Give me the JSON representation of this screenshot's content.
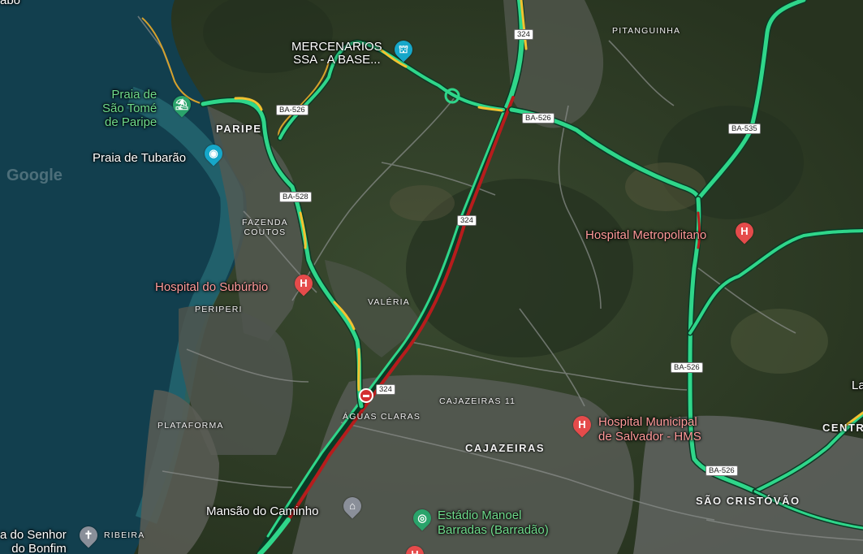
{
  "map": {
    "colors": {
      "sea": "#123f4e",
      "land": "#2f3a2c",
      "urban": "#5a5f5a",
      "traffic_fast": "#2fd68a",
      "traffic_medium": "#f2c230",
      "traffic_slow": "#b71c1c",
      "hospital": "#e54b4b",
      "tourism": "#16a7c9",
      "park": "#2aa36b"
    },
    "watermark": "Google",
    "route_shields": [
      {
        "name": "shield-324-north",
        "label": "324"
      },
      {
        "name": "shield-324-middle",
        "label": "324"
      },
      {
        "name": "shield-324-south",
        "label": "324"
      },
      {
        "name": "shield-ba526-paripe",
        "label": "BA-526"
      },
      {
        "name": "shield-ba526-east",
        "label": "BA-526"
      },
      {
        "name": "shield-ba528",
        "label": "BA-528"
      },
      {
        "name": "shield-ba535",
        "label": "BA-535"
      },
      {
        "name": "shield-ba526-south",
        "label": "BA-526"
      },
      {
        "name": "shield-ba526-bottom",
        "label": "BA-526"
      }
    ],
    "places": {
      "top_left_fragment": "abo",
      "mercenarios_line1": "MERCENARIOS",
      "mercenarios_line2": "SSA - A BASE...",
      "praia_sao_tome_line1": "Praia de",
      "praia_sao_tome_line2": "São Tomé",
      "praia_sao_tome_line3": "de Paripe",
      "praia_tubarao": "Praia de Tubarão",
      "hospital_metropolitano": "Hospital Metropolitano",
      "hospital_suburbio": "Hospital do Subúrbio",
      "hospital_municipal_line1": "Hospital Municipal",
      "hospital_municipal_line2": "de Salvador - HMS",
      "mansao_caminho": "Mansão do Caminho",
      "estadio_line1": "Estádio Manoel",
      "estadio_line2": "Barradas (Barradão)",
      "senhor_bonfim_line1": "a do Senhor",
      "senhor_bonfim_line2": "do Bonfim"
    },
    "neighborhoods": {
      "pitanguinha": "PITANGUINHA",
      "paripe": "PARIPE",
      "fazenda_coutos_line1": "FAZENDA",
      "fazenda_coutos_line2": "COUTOS",
      "periperi": "PERIPERI",
      "valeria": "VALÉRIA",
      "cajazeiras_11": "CAJAZEIRAS 11",
      "aguas_claras": "ÁGUAS CLARAS",
      "cajazeiras": "CAJAZEIRAS",
      "plataforma": "PLATAFORMA",
      "ribeira": "RIBEIRA",
      "sao_cristovao": "SÃO CRISTÓVÃO",
      "centro_fragment": "CENTR",
      "la_fragment": "La"
    },
    "icons": {
      "hospital": "hospital-pin-icon",
      "tourism": "camera-pin-icon",
      "landmark": "landmark-pin-icon",
      "beach": "beach-pin-icon",
      "church": "church-pin-icon",
      "stadium": "stadium-pin-icon",
      "incident": "road-closed-icon"
    }
  }
}
